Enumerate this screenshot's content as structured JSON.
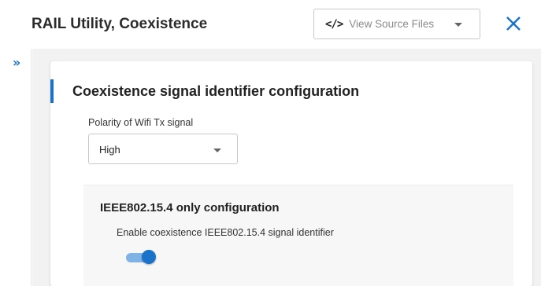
{
  "header": {
    "title": "RAIL Utility, Coexistence",
    "source_button": {
      "icon": "code-icon",
      "icon_glyph": "</>",
      "label": "View Source Files"
    },
    "close_icon": "close-icon"
  },
  "sidebar": {
    "expand_icon": "double-chevron-right-icon",
    "expand_glyph": "»"
  },
  "section": {
    "title": "Coexistence signal identifier configuration",
    "polarity_field": {
      "label": "Polarity of Wifi Tx signal",
      "value": "High"
    }
  },
  "subsection": {
    "title": "IEEE802.15.4 only configuration",
    "toggle": {
      "label": "Enable coexistence IEEE802.15.4 signal identifier",
      "enabled": true
    }
  },
  "colors": {
    "accent": "#1a73c8",
    "toggle_track": "#7fb2e5"
  }
}
